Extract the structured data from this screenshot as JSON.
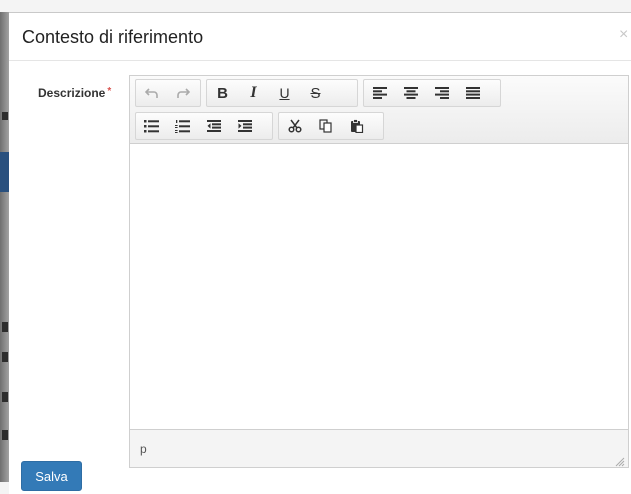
{
  "modal": {
    "title": "Contesto di riferimento",
    "close_label": "×"
  },
  "form": {
    "field_label": "Descrizione",
    "required_mark": "*",
    "save_label": "Salva"
  },
  "editor": {
    "status_path": "p",
    "toolbar": {
      "row1": [
        {
          "name": "undo-icon",
          "enabled": false
        },
        {
          "name": "redo-icon",
          "enabled": false
        },
        {
          "name": "bold-icon",
          "glyph": "B"
        },
        {
          "name": "italic-icon",
          "glyph": "I"
        },
        {
          "name": "underline-icon",
          "glyph": "U"
        },
        {
          "name": "strikethrough-icon",
          "glyph": "S"
        },
        {
          "name": "align-left-icon"
        },
        {
          "name": "align-center-icon"
        },
        {
          "name": "align-right-icon"
        },
        {
          "name": "align-justify-icon"
        }
      ],
      "row2": [
        {
          "name": "bullet-list-icon"
        },
        {
          "name": "numbered-list-icon"
        },
        {
          "name": "outdent-icon"
        },
        {
          "name": "indent-icon"
        },
        {
          "name": "cut-icon"
        },
        {
          "name": "copy-icon"
        },
        {
          "name": "paste-icon"
        }
      ]
    }
  },
  "colors": {
    "primary": "#337ab7",
    "required": "#d9534f"
  }
}
